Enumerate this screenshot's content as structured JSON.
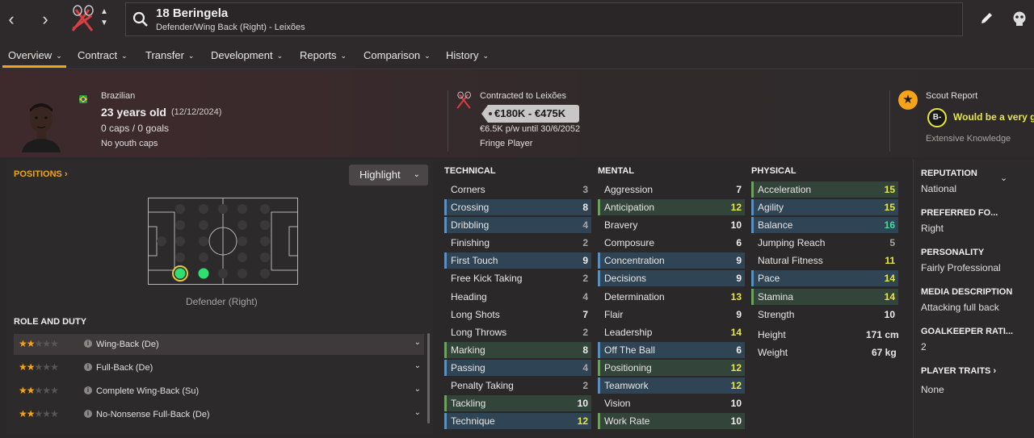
{
  "player": {
    "name": "18 Beringela",
    "subtitle": "Defender/Wing Back (Right) - Leixões"
  },
  "tabs": [
    {
      "label": "Overview"
    },
    {
      "label": "Contract"
    },
    {
      "label": "Transfer"
    },
    {
      "label": "Development"
    },
    {
      "label": "Reports"
    },
    {
      "label": "Comparison"
    },
    {
      "label": "History"
    }
  ],
  "info": {
    "nationality": "Brazilian",
    "age": "23 years old",
    "dob": "(12/12/2024)",
    "caps": "0 caps / 0 goals",
    "youth": "No youth caps"
  },
  "contract": {
    "club": "Contracted to Leixões",
    "value": "€180K - €475K",
    "wage": "€6.5K p/w until 30/6/2052",
    "status": "Fringe Player"
  },
  "scout": {
    "title": "Scout Report",
    "grade": "B-",
    "summary": "Would be a very g",
    "knowledge": "Extensive Knowledge"
  },
  "positions": {
    "title": "POSITIONS",
    "highlight": "Highlight",
    "pitch_label": "Defender (Right)"
  },
  "roles": {
    "title": "ROLE AND DUTY",
    "items": [
      {
        "name": "Wing-Back (De)",
        "stars": 2
      },
      {
        "name": "Full-Back (De)",
        "stars": 2
      },
      {
        "name": "Complete Wing-Back (Su)",
        "stars": 2
      },
      {
        "name": "No-Nonsense Full-Back (De)",
        "stars": 2
      }
    ]
  },
  "technical": {
    "title": "TECHNICAL",
    "attrs": [
      {
        "name": "Corners",
        "value": 3,
        "style": "none"
      },
      {
        "name": "Crossing",
        "value": 8,
        "style": "blue"
      },
      {
        "name": "Dribbling",
        "value": 4,
        "style": "blue"
      },
      {
        "name": "Finishing",
        "value": 2,
        "style": "none"
      },
      {
        "name": "First Touch",
        "value": 9,
        "style": "blue"
      },
      {
        "name": "Free Kick Taking",
        "value": 2,
        "style": "none"
      },
      {
        "name": "Heading",
        "value": 4,
        "style": "none"
      },
      {
        "name": "Long Shots",
        "value": 7,
        "style": "none"
      },
      {
        "name": "Long Throws",
        "value": 2,
        "style": "none"
      },
      {
        "name": "Marking",
        "value": 8,
        "style": "green"
      },
      {
        "name": "Passing",
        "value": 4,
        "style": "blue"
      },
      {
        "name": "Penalty Taking",
        "value": 2,
        "style": "none"
      },
      {
        "name": "Tackling",
        "value": 10,
        "style": "green"
      },
      {
        "name": "Technique",
        "value": 12,
        "style": "blue"
      }
    ]
  },
  "mental": {
    "title": "MENTAL",
    "attrs": [
      {
        "name": "Aggression",
        "value": 7,
        "style": "none"
      },
      {
        "name": "Anticipation",
        "value": 12,
        "style": "green"
      },
      {
        "name": "Bravery",
        "value": 10,
        "style": "none"
      },
      {
        "name": "Composure",
        "value": 6,
        "style": "none"
      },
      {
        "name": "Concentration",
        "value": 9,
        "style": "blue"
      },
      {
        "name": "Decisions",
        "value": 9,
        "style": "blue"
      },
      {
        "name": "Determination",
        "value": 13,
        "style": "none"
      },
      {
        "name": "Flair",
        "value": 9,
        "style": "none"
      },
      {
        "name": "Leadership",
        "value": 14,
        "style": "none"
      },
      {
        "name": "Off The Ball",
        "value": 6,
        "style": "blue"
      },
      {
        "name": "Positioning",
        "value": 12,
        "style": "green"
      },
      {
        "name": "Teamwork",
        "value": 12,
        "style": "blue"
      },
      {
        "name": "Vision",
        "value": 10,
        "style": "none"
      },
      {
        "name": "Work Rate",
        "value": 10,
        "style": "green"
      }
    ]
  },
  "physical": {
    "title": "PHYSICAL",
    "attrs": [
      {
        "name": "Acceleration",
        "value": 15,
        "style": "green"
      },
      {
        "name": "Agility",
        "value": 15,
        "style": "blue"
      },
      {
        "name": "Balance",
        "value": 16,
        "style": "blue"
      },
      {
        "name": "Jumping Reach",
        "value": 5,
        "style": "none"
      },
      {
        "name": "Natural Fitness",
        "value": 11,
        "style": "none"
      },
      {
        "name": "Pace",
        "value": 14,
        "style": "blue"
      },
      {
        "name": "Stamina",
        "value": 14,
        "style": "green"
      },
      {
        "name": "Strength",
        "value": 10,
        "style": "none"
      }
    ],
    "height_label": "Height",
    "height": "171 cm",
    "weight_label": "Weight",
    "weight": "67 kg"
  },
  "side": {
    "reputation_label": "REPUTATION",
    "reputation": "National",
    "foot_label": "PREFERRED FO...",
    "foot": "Right",
    "personality_label": "PERSONALITY",
    "personality": "Fairly Professional",
    "media_label": "MEDIA DESCRIPTION",
    "media": "Attacking full back",
    "gk_label": "GOALKEEPER RATI...",
    "gk": "2",
    "traits_label": "PLAYER TRAITS",
    "traits": "None"
  },
  "colors": {
    "accent": "#f5a31a",
    "blue_row": "#2f4454",
    "green_row": "#33443a",
    "blue_bar": "#5a8fc0",
    "green_bar": "#6fa060",
    "val_white": "#f0eeee",
    "val_grey": "#a8a4a4",
    "val_yellow": "#e6e64a",
    "val_green": "#4ed8a0"
  }
}
